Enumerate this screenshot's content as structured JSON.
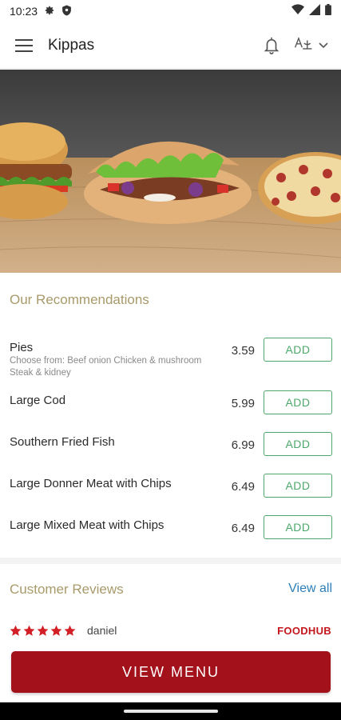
{
  "status_bar": {
    "time": "10:23",
    "icons": [
      "gear-icon",
      "shield-icon",
      "wifi-icon",
      "signal-icon",
      "battery-icon"
    ]
  },
  "app_bar": {
    "title": "Kippas",
    "icons": [
      "menu-icon",
      "bell-icon",
      "language-icon",
      "chevron-down-icon"
    ]
  },
  "recommendations": {
    "title": "Our Recommendations",
    "items": [
      {
        "name": "Pies",
        "description": "Choose from:  Beef onion  Chicken & mushroom  Steak & kidney",
        "price": "3.59",
        "button": "ADD"
      },
      {
        "name": "Large Cod",
        "description": "",
        "price": "5.99",
        "button": "ADD"
      },
      {
        "name": "Southern Fried Fish",
        "description": "",
        "price": "6.99",
        "button": "ADD"
      },
      {
        "name": "Large Donner Meat with Chips",
        "description": "",
        "price": "6.49",
        "button": "ADD"
      },
      {
        "name": "Large Mixed Meat with Chips",
        "description": "",
        "price": "6.49",
        "button": "ADD"
      }
    ]
  },
  "reviews": {
    "title": "Customer Reviews",
    "view_all": "View all",
    "latest": {
      "rating": 5,
      "reviewer": "daniel",
      "source": "FOODHUB"
    }
  },
  "cta": {
    "label": "VIEW MENU"
  },
  "colors": {
    "accent_gold": "#a89a6a",
    "add_green": "#4ea86b",
    "cta_red": "#a3111a",
    "link_blue": "#2f7fb8",
    "star_red": "#d32027"
  }
}
